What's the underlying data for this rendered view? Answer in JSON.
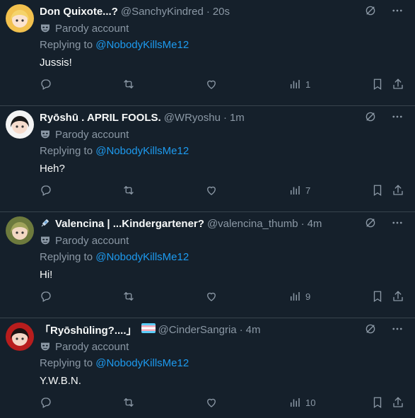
{
  "colors": {
    "background": "#15202b",
    "accent": "#1d9bf0",
    "muted": "#8b98a5",
    "text": "#f7f9f9",
    "divider": "#38444d"
  },
  "tweets": [
    {
      "name": "Don Quixote...?",
      "name_prefix_emoji": "",
      "name_suffix_emoji": "",
      "handle": "@SanchyKindred",
      "time": "20s",
      "parody": "Parody account",
      "replying_prefix": "Replying to",
      "replying_to": "@NobodyKillsMe12",
      "text": "Jussis!",
      "views": "1",
      "avatar": {
        "bg": "#f2c14e",
        "hair": "#f5d36b",
        "skin": "#fbe3cf"
      }
    },
    {
      "name": "Ryōshū . APRIL FOOLS.",
      "name_prefix_emoji": "",
      "name_suffix_emoji": "",
      "handle": "@WRyoshu",
      "time": "1m",
      "parody": "Parody account",
      "replying_prefix": "Replying to",
      "replying_to": "@NobodyKillsMe12",
      "text": "Heh?",
      "views": "7",
      "avatar": {
        "bg": "#f4f4f4",
        "hair": "#1a1a1a",
        "skin": "#f6dccd"
      }
    },
    {
      "name": "Valencina | ...Kindergartener?",
      "name_prefix_emoji": "syringe-emoji",
      "name_suffix_emoji": "",
      "handle": "@valencina_thumb",
      "time": "4m",
      "parody": "Parody account",
      "replying_prefix": "Replying to",
      "replying_to": "@NobodyKillsMe12",
      "text": "Hi!",
      "views": "9",
      "avatar": {
        "bg": "#6d7a3d",
        "hair": "#a0a35a",
        "skin": "#f2d8c2"
      }
    },
    {
      "name": "「Ryōshūling?....」",
      "name_prefix_emoji": "",
      "name_suffix_emoji": "trans-flag-emoji",
      "handle": "@CinderSangria",
      "time": "4m",
      "parody": "Parody account",
      "replying_prefix": "Replying to",
      "replying_to": "@NobodyKillsMe12",
      "text": "Y.W.B.N.",
      "views": "10",
      "avatar": {
        "bg": "#b81d1d",
        "hair": "#1b1212",
        "skin": "#f3d6c6"
      }
    }
  ]
}
